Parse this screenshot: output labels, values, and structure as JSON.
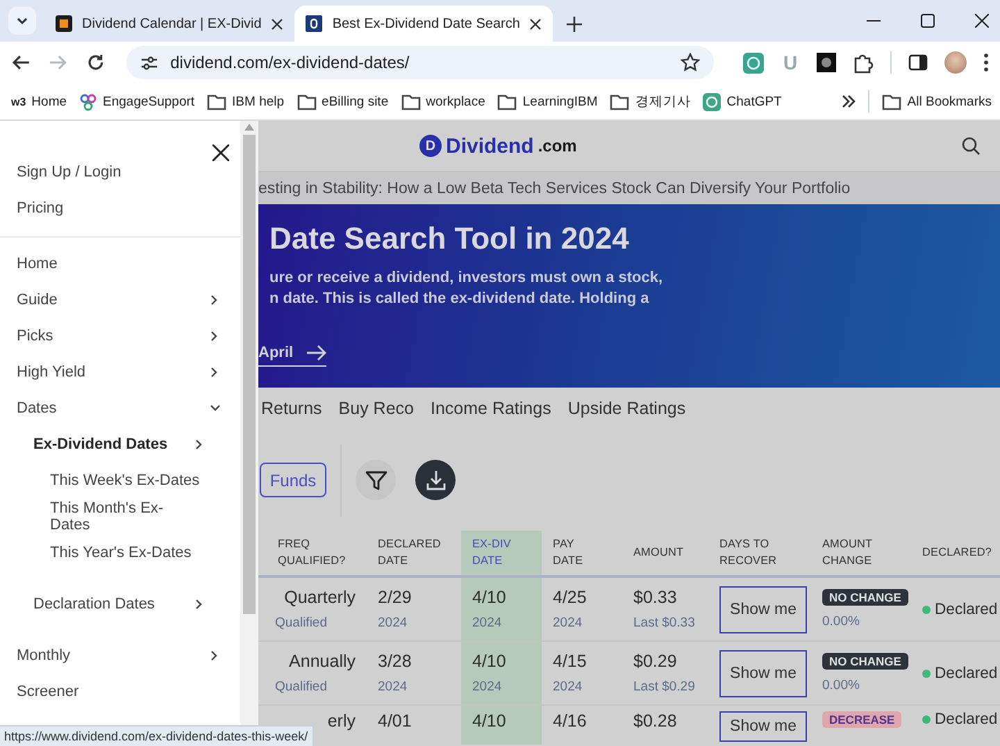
{
  "browser": {
    "tabs": [
      {
        "title": "Dividend Calendar | EX-Divid",
        "kind": "orange",
        "selected": false
      },
      {
        "title": "Best Ex-Dividend Date Search",
        "kind": "blue",
        "selected": true
      }
    ],
    "nav_buttons": [
      {
        "kind": "back",
        "disabled": false
      },
      {
        "kind": "forward",
        "disabled": true
      },
      {
        "kind": "reload",
        "disabled": false
      }
    ],
    "url": "dividend.com/ex-dividend-dates/",
    "extensions": [
      {
        "kind": "green"
      },
      {
        "kind": "letter",
        "label": "U"
      },
      {
        "kind": "black"
      },
      {
        "kind": "puzzle"
      }
    ],
    "bookmarks": [
      {
        "label": "Home",
        "kind": "logo",
        "icon_text": "w3"
      },
      {
        "label": "EngageSupport",
        "kind": "rings"
      },
      {
        "label": "IBM help",
        "kind": "folder"
      },
      {
        "label": "eBilling site",
        "kind": "folder"
      },
      {
        "label": "workplace",
        "kind": "folder"
      },
      {
        "label": "LearningIBM",
        "kind": "folder"
      },
      {
        "label": "경제기사",
        "kind": "folder"
      },
      {
        "label": "ChatGPT",
        "kind": "app"
      }
    ],
    "all_bookmarks": "All Bookmarks"
  },
  "drawer": {
    "top_links": [
      "Sign Up / Login",
      "Pricing"
    ],
    "items": [
      {
        "label": "Home",
        "selected": false
      },
      {
        "label": "Guide",
        "kind": "submenu",
        "selected": false
      },
      {
        "label": "Picks",
        "kind": "submenu",
        "selected": false
      },
      {
        "label": "High Yield",
        "kind": "submenu",
        "selected": false
      },
      {
        "label": "Dates",
        "kind": "open",
        "selected": false,
        "children": [
          {
            "label": "Ex-Dividend Dates",
            "kind": "submenu",
            "selected": true,
            "children": [
              {
                "label": "This Week's Ex-Dates",
                "selected": false
              },
              {
                "label": "This Month's Ex-Dates",
                "selected": false
              },
              {
                "label": "This Year's Ex-Dates",
                "selected": false
              }
            ]
          },
          {
            "label": "Declaration Dates",
            "kind": "submenu",
            "selected": false
          }
        ]
      },
      {
        "label": "Monthly",
        "kind": "submenu",
        "selected": false
      },
      {
        "label": "Screener",
        "selected": false
      }
    ]
  },
  "page": {
    "logo": {
      "mark": "D",
      "name": "Dividend",
      "suffix": ".com"
    },
    "ticker": "esting in Stability: How a Low Beta Tech Services Stock Can Diversify Your Portfolio",
    "hero": {
      "title": "Date Search Tool in 2024",
      "lines": [
        "ure or receive a dividend, investors must own a stock,",
        "n date. This is called the ex-dividend date. Holding a"
      ],
      "link": "April"
    },
    "nav_links": [
      "Returns",
      "Buy Reco",
      "Income Ratings",
      "Upside Ratings"
    ],
    "filter_button": "Funds",
    "table": {
      "columns": [
        {
          "label": "FREQ QUALIFIED?",
          "highlighted": false
        },
        {
          "label": "DECLARED DATE",
          "highlighted": false
        },
        {
          "label": "EX-DIV DATE",
          "highlighted": true
        },
        {
          "label": "PAY DATE",
          "highlighted": false
        },
        {
          "label": "AMOUNT",
          "highlighted": false
        },
        {
          "label": "DAYS TO RECOVER",
          "highlighted": false
        },
        {
          "label": "AMOUNT CHANGE",
          "highlighted": false
        },
        {
          "label": "DECLARED?",
          "highlighted": false
        }
      ],
      "rows": [
        {
          "frequency": "Quarterly",
          "qualified": "Qualified",
          "declared": "2/29",
          "declared_year": "2024",
          "ex_div": "4/10",
          "ex_div_year": "2024",
          "pay": "4/25",
          "pay_year": "2024",
          "amount": "$0.33",
          "last_amount": "Last $0.33",
          "recover_button": "Show me",
          "change": {
            "label": "NO CHANGE",
            "kind": "no_change"
          },
          "change_percent": "0.00%",
          "status": {
            "label": "Declared",
            "color": "#3cb878"
          }
        },
        {
          "frequency": "Annually",
          "qualified": "Qualified",
          "declared": "3/28",
          "declared_year": "2024",
          "ex_div": "4/10",
          "ex_div_year": "2024",
          "pay": "4/15",
          "pay_year": "2024",
          "amount": "$0.29",
          "last_amount": "Last $0.29",
          "recover_button": "Show me",
          "change": {
            "label": "NO CHANGE",
            "kind": "no_change"
          },
          "change_percent": "0.00%",
          "status": {
            "label": "Declared",
            "color": "#3cb878"
          }
        },
        {
          "frequency": "erly",
          "declared": "4/01",
          "ex_div": "4/10",
          "pay": "4/16",
          "amount": "$0.28",
          "recover_button": "Show me",
          "change": {
            "label": "DECREASE",
            "kind": "decrease"
          },
          "status": {
            "label": "Declared",
            "color": "#3cb878"
          }
        }
      ]
    }
  },
  "status_url": "https://www.dividend.com/ex-dividend-dates-this-week/"
}
